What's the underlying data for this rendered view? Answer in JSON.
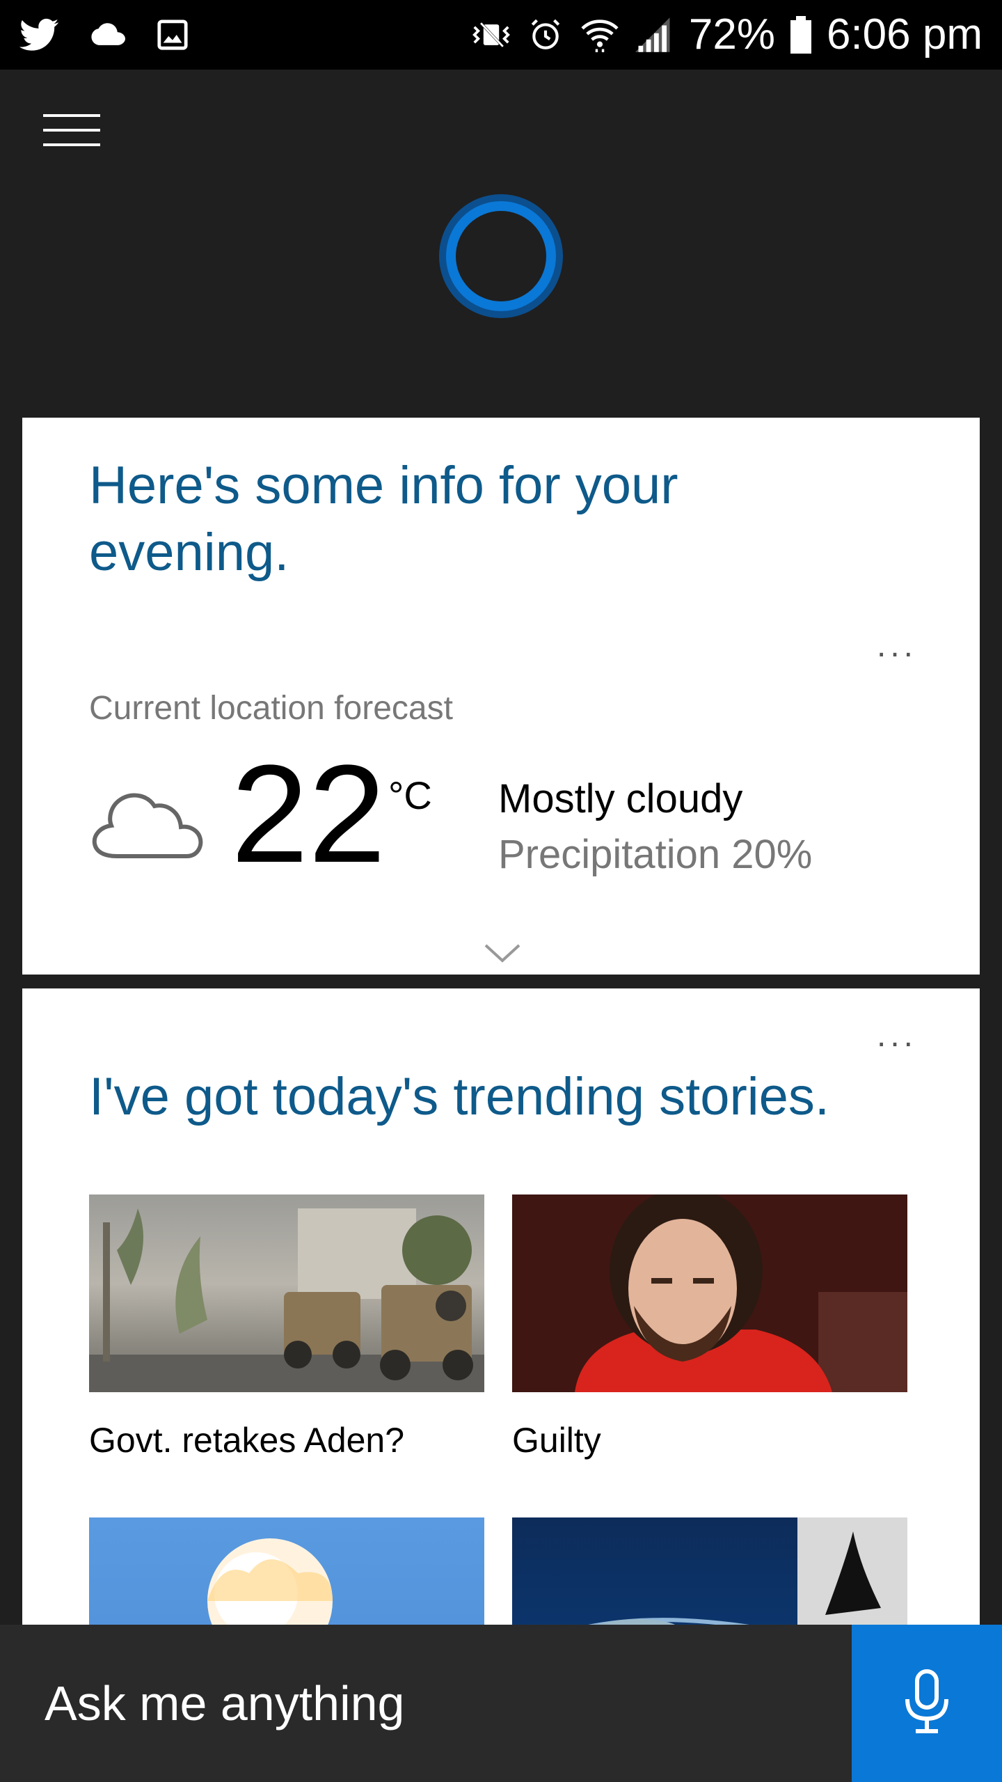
{
  "status_bar": {
    "battery": "72%",
    "time": "6:06 pm",
    "icons_left": [
      "twitter-icon",
      "cloud-icon",
      "gallery-icon"
    ],
    "icons_right": [
      "vibrate-icon",
      "alarm-icon",
      "wifi-icon",
      "signal-icon",
      "battery-icon"
    ]
  },
  "header": {
    "menu_icon": "hamburger-icon",
    "logo": "cortana-icon"
  },
  "evening_card": {
    "title": "Here's some info for your evening.",
    "more": "...",
    "location_label": "Current location forecast",
    "temperature": "22",
    "unit": "°C",
    "condition": "Mostly cloudy",
    "precipitation": "Precipitation 20%",
    "icon": "cloud-icon",
    "expand_icon": "chevron-down-icon"
  },
  "trending_card": {
    "title": "I've got today's trending stories.",
    "more": "...",
    "stories": [
      {
        "caption": "Govt. retakes Aden?"
      },
      {
        "caption": "Guilty"
      },
      {
        "caption": ""
      },
      {
        "caption": ""
      }
    ]
  },
  "ask_bar": {
    "placeholder": "Ask me anything",
    "mic_icon": "microphone-icon",
    "colors": {
      "mic_bg": "#0a78d6"
    }
  },
  "colors": {
    "title_blue": "#0e5a8a",
    "cortana_blue": "#0a78d6",
    "background": "#1f1f1f"
  }
}
